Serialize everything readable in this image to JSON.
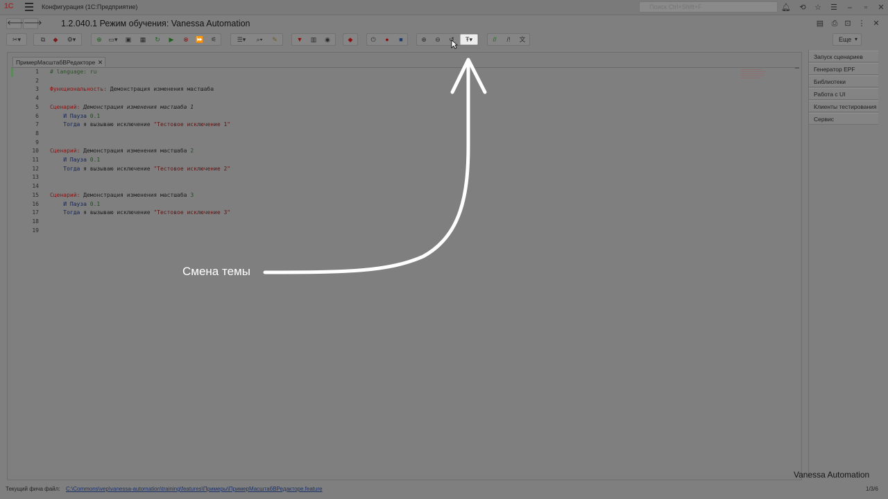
{
  "app": {
    "logo": "1С",
    "window_title": "Конфигурация (1С:Предприятие)",
    "search_placeholder": "Поиск Ctrl+Shift+F"
  },
  "header": {
    "title": "1.2.040.1 Режим обучения: Vanessa Automation"
  },
  "toolbar": {
    "more_label": "Еще",
    "active_button": "theme-switch-button"
  },
  "editor": {
    "tab_label": "ПримерМасштабВРедакторе",
    "lines": [
      {
        "n": "1",
        "parts": [
          {
            "t": "# language: ru",
            "c": "k-cmt"
          }
        ]
      },
      {
        "n": "2",
        "parts": []
      },
      {
        "n": "3",
        "parts": [
          {
            "t": "Функциональность:",
            "c": "k-red"
          },
          {
            "t": " Демонстрация изменения мастшаба",
            "c": ""
          }
        ]
      },
      {
        "n": "4",
        "parts": []
      },
      {
        "n": "5",
        "parts": [
          {
            "t": "Сценарий:",
            "c": "k-red"
          },
          {
            "t": " Демонстрация изменения мастшаба 1",
            "c": "k-ital"
          }
        ]
      },
      {
        "n": "6",
        "parts": [
          {
            "t": "    И Пауза ",
            "c": "k-blue"
          },
          {
            "t": "0.1",
            "c": "k-num"
          }
        ]
      },
      {
        "n": "7",
        "parts": [
          {
            "t": "    Тогда",
            "c": "k-blue"
          },
          {
            "t": " я вызываю исключение ",
            "c": ""
          },
          {
            "t": "\"Тестовое исключение 1\"",
            "c": "k-str"
          }
        ]
      },
      {
        "n": "8",
        "parts": []
      },
      {
        "n": "9",
        "parts": []
      },
      {
        "n": "10",
        "parts": [
          {
            "t": "Сценарий:",
            "c": "k-red"
          },
          {
            "t": " Демонстрация изменения мастшаба ",
            "c": ""
          },
          {
            "t": "2",
            "c": "k-num"
          }
        ]
      },
      {
        "n": "11",
        "parts": [
          {
            "t": "    И Пауза ",
            "c": "k-blue"
          },
          {
            "t": "0.1",
            "c": "k-num"
          }
        ]
      },
      {
        "n": "12",
        "parts": [
          {
            "t": "    Тогда",
            "c": "k-blue"
          },
          {
            "t": " я вызываю исключение ",
            "c": ""
          },
          {
            "t": "\"Тестовое исключение 2\"",
            "c": "k-str"
          }
        ]
      },
      {
        "n": "13",
        "parts": []
      },
      {
        "n": "14",
        "parts": []
      },
      {
        "n": "15",
        "parts": [
          {
            "t": "Сценарий:",
            "c": "k-red"
          },
          {
            "t": " Демонстрация изменения мастшаба ",
            "c": ""
          },
          {
            "t": "3",
            "c": "k-num"
          }
        ]
      },
      {
        "n": "16",
        "parts": [
          {
            "t": "    И Пауза ",
            "c": "k-blue"
          },
          {
            "t": "0.1",
            "c": "k-num"
          }
        ]
      },
      {
        "n": "17",
        "parts": [
          {
            "t": "    Тогда",
            "c": "k-blue"
          },
          {
            "t": " я вызываю исключение ",
            "c": ""
          },
          {
            "t": "\"Тестовое исключение 3\"",
            "c": "k-str"
          }
        ]
      },
      {
        "n": "18",
        "parts": []
      },
      {
        "n": "19",
        "parts": []
      }
    ]
  },
  "right_panel": {
    "items": [
      "Запуск сценариев",
      "Генератор EPF",
      "Библиотеки",
      "Работа с UI",
      "Клиенты тестирования",
      "Сервис"
    ]
  },
  "status": {
    "prefix": "Текущий фича файл:",
    "path": "C:\\Commons\\vep\\vanessa-automation\\training\\features\\Примеры\\ПримерМасштабВРедакторе.feature",
    "counter": "1/3/6"
  },
  "annotation": {
    "text": "Смена темы",
    "color": "#ffffff"
  },
  "brand": {
    "watermark": "Vanessa Automation"
  }
}
